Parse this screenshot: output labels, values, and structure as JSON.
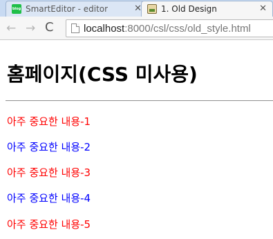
{
  "tabs": [
    {
      "title": "SmartEditor - editor",
      "favicon": "blog-favicon-icon",
      "active": false
    },
    {
      "title": "1. Old Design",
      "favicon": "image-favicon-icon",
      "active": true
    }
  ],
  "toolbar": {
    "back_icon": "←",
    "forward_icon": "→",
    "reload_icon": "C",
    "url_host": "localhost",
    "url_path": ":8000/csl/css/old_style.html"
  },
  "page": {
    "heading": "홈페이지(CSS 미사용)",
    "paragraphs": [
      {
        "text": "아주 중요한 내용-1",
        "color": "#ff0000"
      },
      {
        "text": "아주 중요한 내용-2",
        "color": "#0000ff"
      },
      {
        "text": "아주 중요한 내용-3",
        "color": "#ff0000"
      },
      {
        "text": "아주 중요한 내용-4",
        "color": "#0000ff"
      },
      {
        "text": "아주 중요한 내용-5",
        "color": "#ff0000"
      }
    ]
  }
}
